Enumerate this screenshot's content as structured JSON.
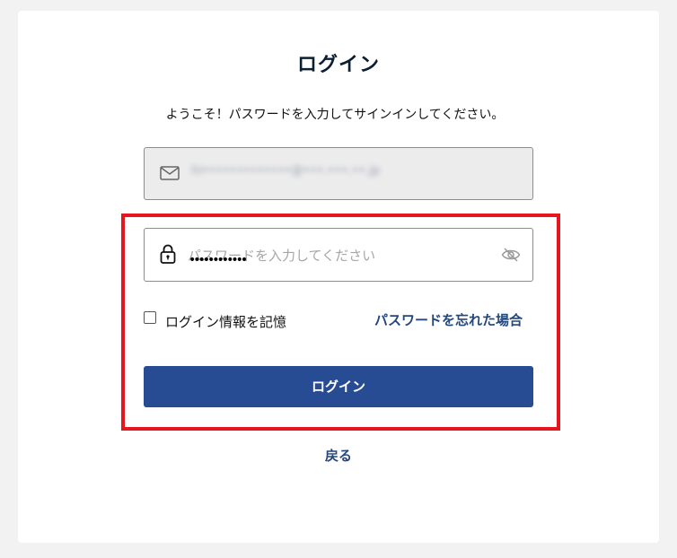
{
  "page": {
    "title": "ログイン",
    "subtitle": "ようこそ！パスワードを入力してサインインしてください。"
  },
  "email": {
    "icon": "mail-icon",
    "value": "hi•••••••••••••@•••.•••.••.jp"
  },
  "password": {
    "icon": "lock-icon",
    "placeholder": "パスワードを入力してください",
    "masked_value": "••••••••••••",
    "toggle_icon": "eye-slash-icon"
  },
  "remember": {
    "label": "ログイン情報を記憶",
    "checked": false
  },
  "links": {
    "forgot_password": "パスワードを忘れた場合",
    "back": "戻る"
  },
  "buttons": {
    "login": "ログイン"
  },
  "colors": {
    "primary": "#284c93",
    "link": "#24477c",
    "highlight": "#e5161d",
    "background": "#f2f2f2"
  }
}
